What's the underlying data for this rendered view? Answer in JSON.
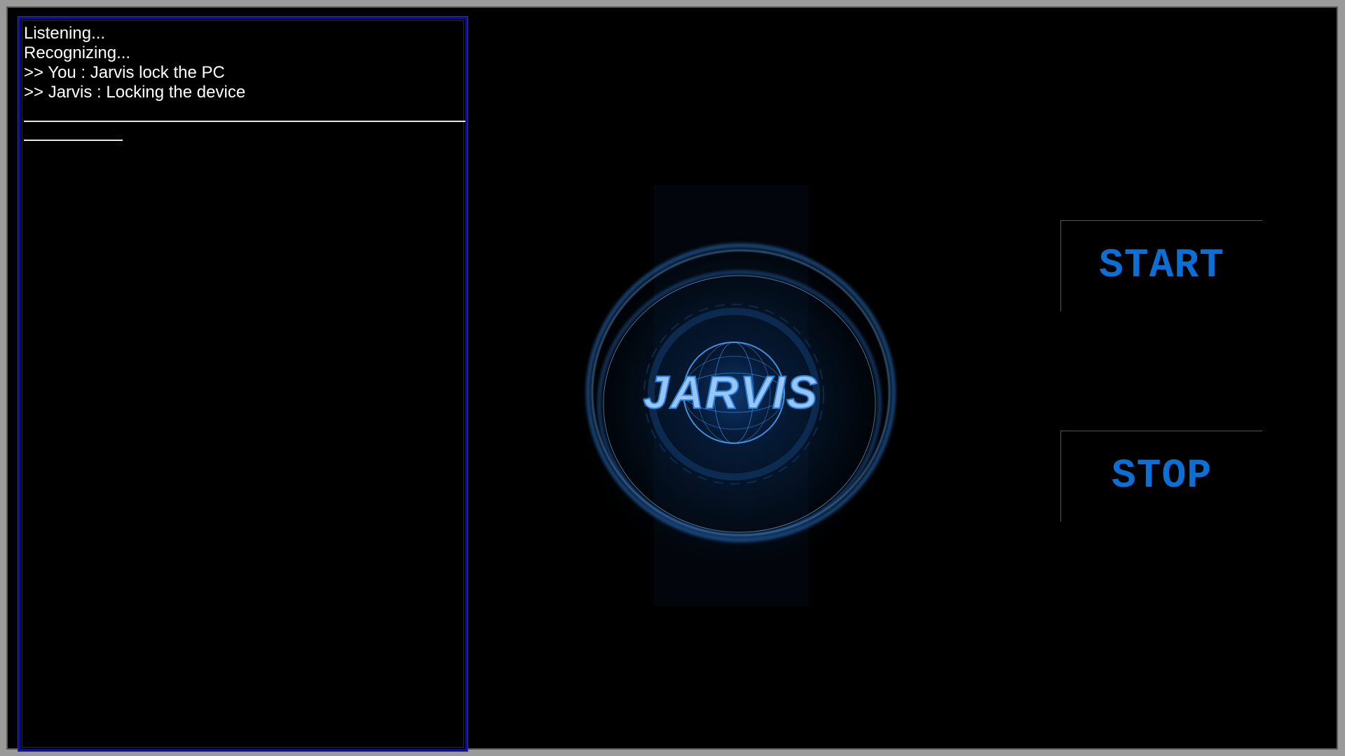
{
  "console": {
    "lines": [
      "Listening...",
      "Recognizing...",
      ">> You : Jarvis lock the PC",
      ">> Jarvis : Locking the device"
    ]
  },
  "logo": {
    "text": "JARVIS",
    "accent": "#1f7fe0",
    "glow": "#0a3f8a"
  },
  "controls": {
    "start_label": "START",
    "stop_label": "STOP",
    "accent": "#0b6fd6"
  }
}
